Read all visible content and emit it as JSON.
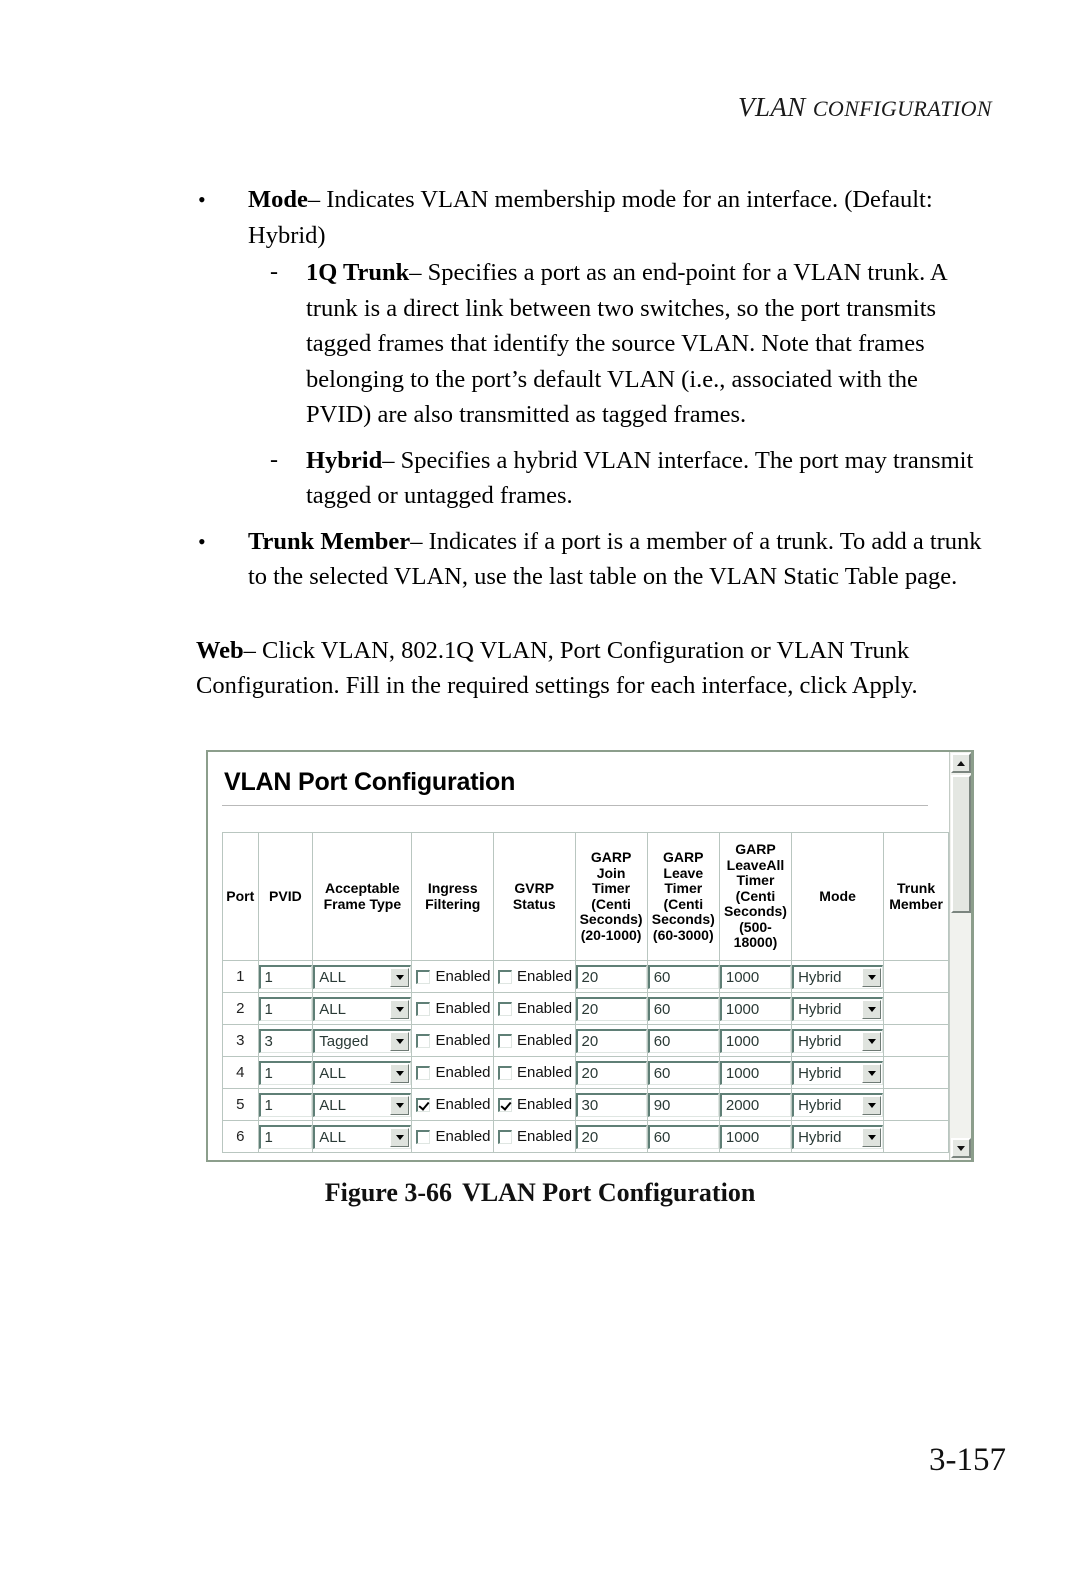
{
  "header": {
    "running_head_first": "VLAN",
    "running_head_rest": "Configuration"
  },
  "body": {
    "bullets": [
      {
        "label": "Mode",
        "dash": "–",
        "text": " Indicates VLAN membership mode for an interface. (Default: Hybrid)",
        "sub_items": [
          {
            "marker": "-",
            "label": "1Q Trunk",
            "dash": "–",
            "text": " Specifies a port as an end-point for a VLAN trunk. A trunk is a direct link between two switches, so the port transmits tagged frames that identify the source VLAN. Note that frames belonging to the port’s default VLAN (i.e., associated with the PVID) are also transmitted as tagged frames."
          },
          {
            "marker": "-",
            "label": "Hybrid",
            "dash": "–",
            "text": " Specifies a hybrid VLAN interface. The port may transmit tagged or untagged frames."
          }
        ]
      },
      {
        "label": "Trunk Member",
        "dash": "–",
        "text": " Indicates if a port is a member of a trunk. To add a trunk to the selected VLAN, use the last table on the VLAN Static Table page.",
        "sub_items": []
      }
    ],
    "web_label": "Web",
    "web_dash": "–",
    "web_text": " Click VLAN, 802.1Q VLAN, Port Configuration or VLAN Trunk Configuration. Fill in the required settings for each interface, click Apply."
  },
  "figure": {
    "panel_title": "VLAN Port Configuration",
    "columns": [
      "Port",
      "PVID",
      "Acceptable Frame Type",
      "Ingress Filtering",
      "GVRP Status",
      "GARP Join Timer (Centi Seconds) (20-1000)",
      "GARP Leave Timer (Centi Seconds) (60-3000)",
      "GARP LeaveAll Timer (Centi Seconds) (500-18000)",
      "Mode",
      "Trunk Member"
    ],
    "column_lines": {
      "port": [
        "Port"
      ],
      "pvid": [
        "PVID"
      ],
      "acceptable_frame_type": [
        "Acceptable",
        "Frame Type"
      ],
      "ingress_filtering": [
        "Ingress",
        "Filtering"
      ],
      "gvrp_status": [
        "GVRP",
        "Status"
      ],
      "garp_join": [
        "GARP",
        "Join",
        "Timer",
        "(Centi",
        "Seconds)",
        "(20-1000)"
      ],
      "garp_leave": [
        "GARP",
        "Leave",
        "Timer",
        "(Centi",
        "Seconds)",
        "(60-3000)"
      ],
      "garp_leaveall": [
        "GARP",
        "LeaveAll",
        "Timer",
        "(Centi",
        "Seconds)",
        "(500-",
        "18000)"
      ],
      "mode": [
        "Mode"
      ],
      "trunk_member": [
        "Trunk",
        "Member"
      ]
    },
    "checkbox_label": "Enabled",
    "rows": [
      {
        "port": "1",
        "pvid": "1",
        "frame_type": "ALL",
        "ingress_filtering": false,
        "gvrp_status": false,
        "garp_join": "20",
        "garp_leave": "60",
        "garp_leaveall": "1000",
        "mode": "Hybrid",
        "trunk_member": ""
      },
      {
        "port": "2",
        "pvid": "1",
        "frame_type": "ALL",
        "ingress_filtering": false,
        "gvrp_status": false,
        "garp_join": "20",
        "garp_leave": "60",
        "garp_leaveall": "1000",
        "mode": "Hybrid",
        "trunk_member": ""
      },
      {
        "port": "3",
        "pvid": "3",
        "frame_type": "Tagged",
        "ingress_filtering": false,
        "gvrp_status": false,
        "garp_join": "20",
        "garp_leave": "60",
        "garp_leaveall": "1000",
        "mode": "Hybrid",
        "trunk_member": ""
      },
      {
        "port": "4",
        "pvid": "1",
        "frame_type": "ALL",
        "ingress_filtering": false,
        "gvrp_status": false,
        "garp_join": "20",
        "garp_leave": "60",
        "garp_leaveall": "1000",
        "mode": "Hybrid",
        "trunk_member": ""
      },
      {
        "port": "5",
        "pvid": "1",
        "frame_type": "ALL",
        "ingress_filtering": true,
        "gvrp_status": true,
        "garp_join": "30",
        "garp_leave": "90",
        "garp_leaveall": "2000",
        "mode": "Hybrid",
        "trunk_member": ""
      },
      {
        "port": "6",
        "pvid": "1",
        "frame_type": "ALL",
        "ingress_filtering": false,
        "gvrp_status": false,
        "garp_join": "20",
        "garp_leave": "60",
        "garp_leaveall": "1000",
        "mode": "Hybrid",
        "trunk_member": ""
      }
    ],
    "scrollbar": {
      "up_icon": "triangle-up-icon",
      "down_icon": "triangle-down-icon"
    }
  },
  "caption": {
    "number": "Figure 3-66",
    "title": "VLAN Port Configuration"
  },
  "folio": "3-157"
}
